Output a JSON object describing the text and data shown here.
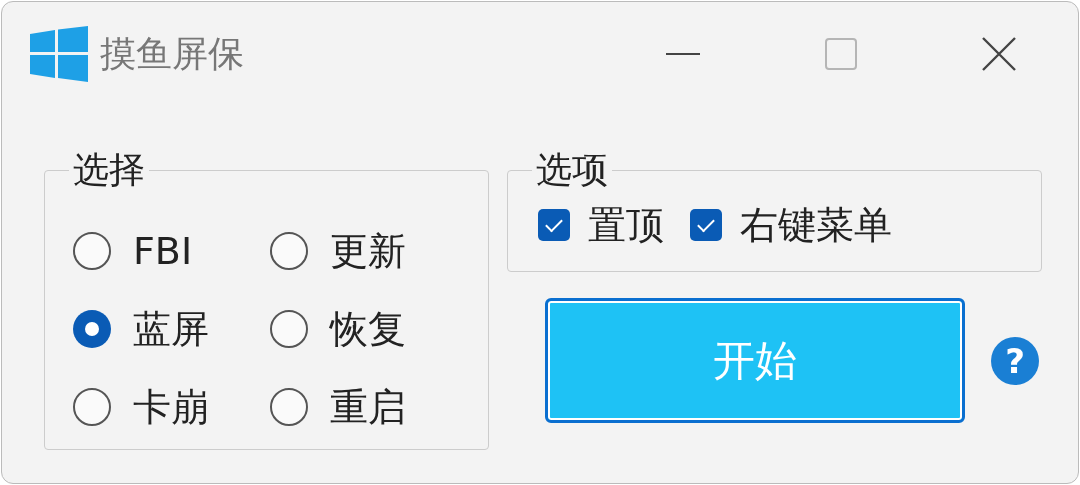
{
  "window": {
    "title": "摸鱼屏保"
  },
  "title_buttons": [
    {
      "kind": "minimize",
      "disabled": false
    },
    {
      "kind": "maximize",
      "disabled": true
    },
    {
      "kind": "close",
      "disabled": false
    }
  ],
  "choice_group": {
    "title": "选择",
    "options": [
      {
        "label": "FBI",
        "selected": false
      },
      {
        "label": "更新",
        "selected": false
      },
      {
        "label": "蓝屏",
        "selected": true
      },
      {
        "label": "恢复",
        "selected": false
      },
      {
        "label": "卡崩",
        "selected": false
      },
      {
        "label": "重启",
        "selected": false
      }
    ]
  },
  "options_group": {
    "title": "选项",
    "items": [
      {
        "label": "置顶",
        "checked": true
      },
      {
        "label": "右键菜单",
        "checked": true
      }
    ]
  },
  "start_button": {
    "label": "开始"
  },
  "help": {
    "label": "?"
  }
}
